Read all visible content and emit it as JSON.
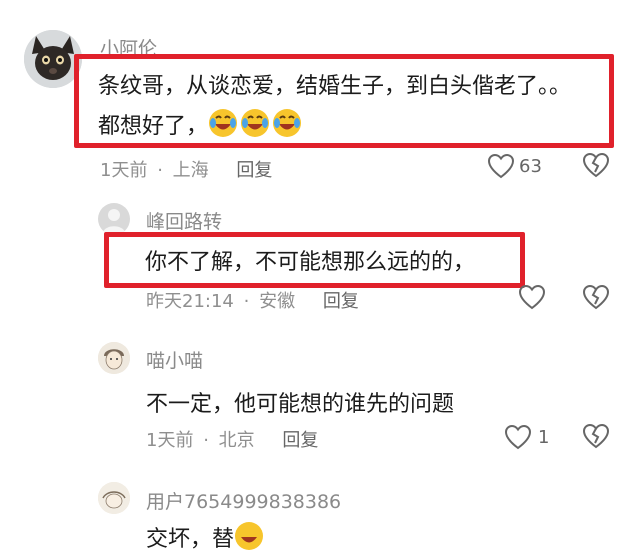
{
  "comments": [
    {
      "username": "小阿伦",
      "text_line1": "条纹哥，从谈恋爱，结婚生子，到白头偕老了。。",
      "text_line2": "都想好了，",
      "emoji_count": 3,
      "time": "1天前",
      "location": "上海",
      "reply_label": "回复",
      "likes": "63"
    },
    {
      "username": "峰回路转",
      "text": "你不了解，不可能想那么远的的，",
      "time": "昨天21:14",
      "location": "安徽",
      "reply_label": "回复"
    },
    {
      "username": "喵小喵",
      "text": "不一定，他可能想的谁先的问题",
      "time": "1天前",
      "location": "北京",
      "reply_label": "回复",
      "likes": "1"
    },
    {
      "username": "用户7654999838386",
      "text": "交坏，替"
    }
  ],
  "separator": "·",
  "colors": {
    "highlight_border": "#e0212b",
    "meta_text": "#8f8f8f"
  },
  "icons": [
    "heart-outline-icon",
    "broken-heart-icon",
    "laughing-tears-emoji-icon"
  ]
}
